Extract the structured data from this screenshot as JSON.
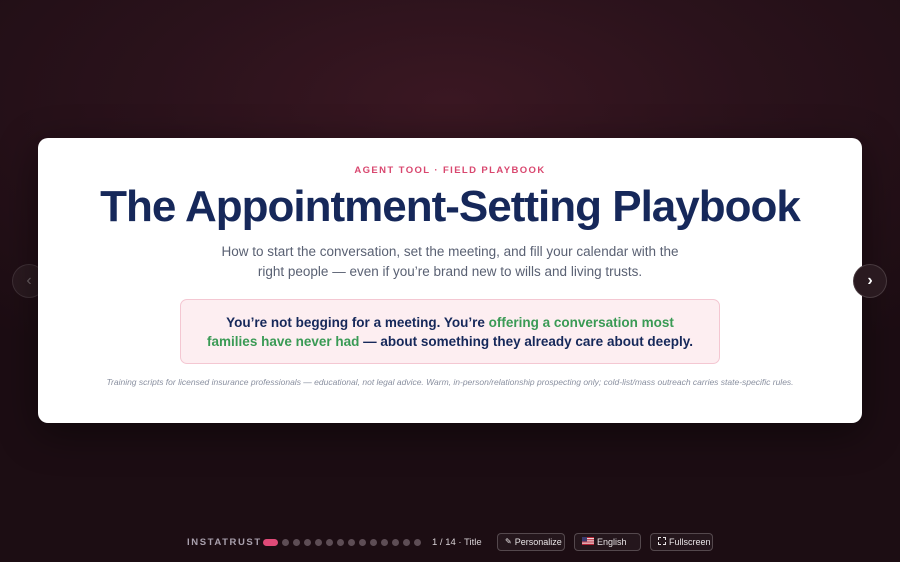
{
  "slide": {
    "eyebrow": "AGENT TOOL · FIELD PLAYBOOK",
    "title": "The Appointment-Setting Playbook",
    "subtitle": "How to start the conversation, set the meeting, and fill your calendar with the right people — even if you’re brand new to wills and living trusts.",
    "callout": {
      "part1": "You’re not begging for a meeting. You’re ",
      "highlight": "offering a conversation most families have never had",
      "part2": " — about something they already care about deeply."
    },
    "disclaimer": "Training scripts for licensed insurance professionals — educational, not legal advice. Warm, in-person/relationship prospecting only; cold-list/mass outreach carries state-specific rules."
  },
  "nav": {
    "prev_icon": "chevron-left-icon",
    "next_icon": "chevron-right-icon"
  },
  "footer": {
    "brand": "INSTATRUST",
    "total_slides": 14,
    "current_slide": 1,
    "counter": "1 / 14 · Title",
    "personalize_label": "Personalize",
    "personalize_icon": "pencil-icon",
    "language_label": "English",
    "language_icon": "us-flag-icon",
    "fullscreen_label": "Fullscreen",
    "fullscreen_icon": "expand-icon"
  },
  "colors": {
    "accent": "#e04a78",
    "title": "#16285a",
    "highlight": "#3a9a55",
    "eyebrow": "#d9476f"
  }
}
